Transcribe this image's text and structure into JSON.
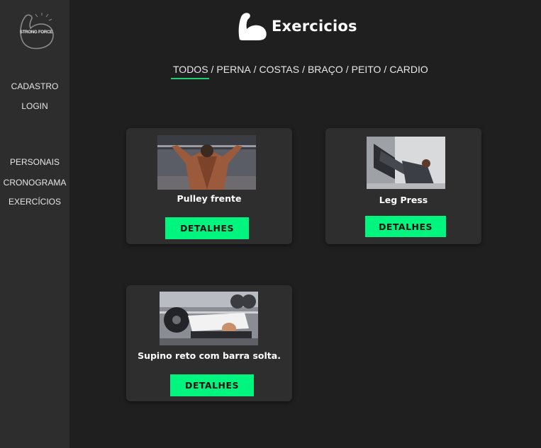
{
  "brand": {
    "logo_text": "STRONG FORCE"
  },
  "sidebar": {
    "items": [
      {
        "label": "CADASTRO"
      },
      {
        "label": "LOGIN"
      },
      {
        "label": "PERSONAIS"
      },
      {
        "label": "CRONOGRAMA"
      },
      {
        "label": "EXERCÍCIOS"
      }
    ]
  },
  "header": {
    "title": "Exercicios",
    "icon": "flexed-arm-icon"
  },
  "filters": {
    "items": [
      "TODOS",
      "PERNA",
      "COSTAS",
      "BRAÇO",
      "PEITO",
      "CARDIO"
    ],
    "separator": "/",
    "active": "TODOS",
    "accent_color": "#1fcf73"
  },
  "exercises": [
    {
      "name": "Pulley frente",
      "button": "DETALHES",
      "image": "back-muscles-photo"
    },
    {
      "name": "Leg Press",
      "button": "DETALHES",
      "image": "leg-press-photo"
    },
    {
      "name": "Supino reto com barra solta.",
      "button": "DETALHES",
      "image": "bench-press-photo"
    }
  ],
  "colors": {
    "button": "#00f57f",
    "sidebar": "#2d2d2d",
    "background": "#1f1f1f",
    "card": "#2e2e2e"
  }
}
